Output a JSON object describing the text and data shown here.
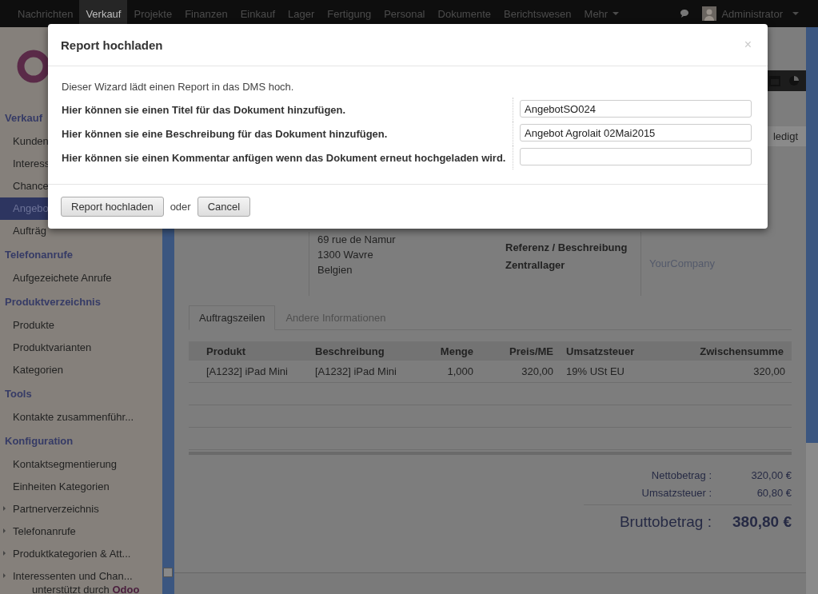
{
  "navbar": {
    "menus": [
      {
        "label": "Nachrichten",
        "selected": false,
        "dropdown": false
      },
      {
        "label": "Verkauf",
        "selected": true,
        "dropdown": false
      },
      {
        "label": "Projekte",
        "selected": false,
        "dropdown": false
      },
      {
        "label": "Finanzen",
        "selected": false,
        "dropdown": false
      },
      {
        "label": "Einkauf",
        "selected": false,
        "dropdown": false
      },
      {
        "label": "Lager",
        "selected": false,
        "dropdown": false
      },
      {
        "label": "Fertigung",
        "selected": false,
        "dropdown": false
      },
      {
        "label": "Personal",
        "selected": false,
        "dropdown": false
      },
      {
        "label": "Dokumente",
        "selected": false,
        "dropdown": false
      },
      {
        "label": "Berichtswesen",
        "selected": false,
        "dropdown": false
      },
      {
        "label": "Mehr",
        "selected": false,
        "dropdown": true
      }
    ],
    "user": {
      "name": "Administrator"
    }
  },
  "sidebar": {
    "sections": [
      {
        "title": "Verkauf",
        "items": [
          {
            "label": "Kunden",
            "selected": false,
            "expandable": false
          },
          {
            "label": "Interess",
            "selected": false,
            "expandable": false
          },
          {
            "label": "Chance",
            "selected": false,
            "expandable": false
          },
          {
            "label": "Angebo",
            "selected": true,
            "expandable": false
          },
          {
            "label": "Aufträg",
            "selected": false,
            "expandable": false
          }
        ]
      },
      {
        "title": "Telefonanrufe",
        "items": [
          {
            "label": "Aufgezeichete Anrufe",
            "selected": false,
            "expandable": false
          }
        ]
      },
      {
        "title": "Produktverzeichnis",
        "items": [
          {
            "label": "Produkte",
            "selected": false,
            "expandable": false
          },
          {
            "label": "Produktvarianten",
            "selected": false,
            "expandable": false
          },
          {
            "label": "Kategorien",
            "selected": false,
            "expandable": false
          }
        ]
      },
      {
        "title": "Tools",
        "items": [
          {
            "label": "Kontakte zusammenführ...",
            "selected": false,
            "expandable": false
          }
        ]
      },
      {
        "title": "Konfiguration",
        "items": [
          {
            "label": "Kontaktsegmentierung",
            "selected": false,
            "expandable": false
          },
          {
            "label": "Einheiten Kategorien",
            "selected": false,
            "expandable": false
          },
          {
            "label": "Partnerverzeichnis",
            "selected": false,
            "expandable": true
          },
          {
            "label": "Telefonanrufe",
            "selected": false,
            "expandable": true
          },
          {
            "label": "Produktkategorien & Att...",
            "selected": false,
            "expandable": true
          },
          {
            "label": "Interessenten und Chan...",
            "selected": false,
            "expandable": true
          }
        ]
      }
    ],
    "footer": {
      "text": "unterstützt durch",
      "brand": "Odoo"
    }
  },
  "status_button": {
    "label": "ledigt"
  },
  "customer_address": [
    "69 rue de Namur",
    "1300 Wavre",
    "Belgien"
  ],
  "info_labels": [
    "Referenz / Beschreibung",
    "Zentrallager"
  ],
  "company": "YourCompany",
  "tabs": [
    {
      "label": "Auftragszeilen",
      "selected": true
    },
    {
      "label": "Andere Informationen",
      "selected": false
    }
  ],
  "table": {
    "columns": [
      "Produkt",
      "Beschreibung",
      "Menge",
      "Preis/ME",
      "Umsatzsteuer",
      "Zwischensumme"
    ],
    "rows": [
      [
        "[A1232] iPad Mini",
        "[A1232] iPad Mini",
        "1,000",
        "320,00",
        "19% USt EU",
        "320,00"
      ]
    ]
  },
  "totals": [
    {
      "label": "Nettobetrag :",
      "value": "320,00 €",
      "kind": "sub"
    },
    {
      "label": "Umsatzsteuer :",
      "value": "60,80 €",
      "kind": "sub"
    },
    {
      "label": "Bruttobetrag :",
      "value": "380,80 €",
      "kind": "grand"
    }
  ],
  "dialog": {
    "title": "Report hochladen",
    "close": "×",
    "intro": "Dieser Wizard lädt einen Report in das DMS hoch.",
    "fields": [
      {
        "label": "Hier können sie einen Titel für das Dokument hinzufügen.",
        "value": "AngebotSO024"
      },
      {
        "label": "Hier können sie eine Beschreibung für das Dokument hinzufügen.",
        "value": "Angebot Agrolait 02Mai2015"
      },
      {
        "label": "Hier können sie einen Kommentar anfügen wenn das Dokument erneut hochgeladen wird."
      }
    ],
    "submit": "Report hochladen",
    "separator": "oder",
    "cancel": "Cancel"
  }
}
